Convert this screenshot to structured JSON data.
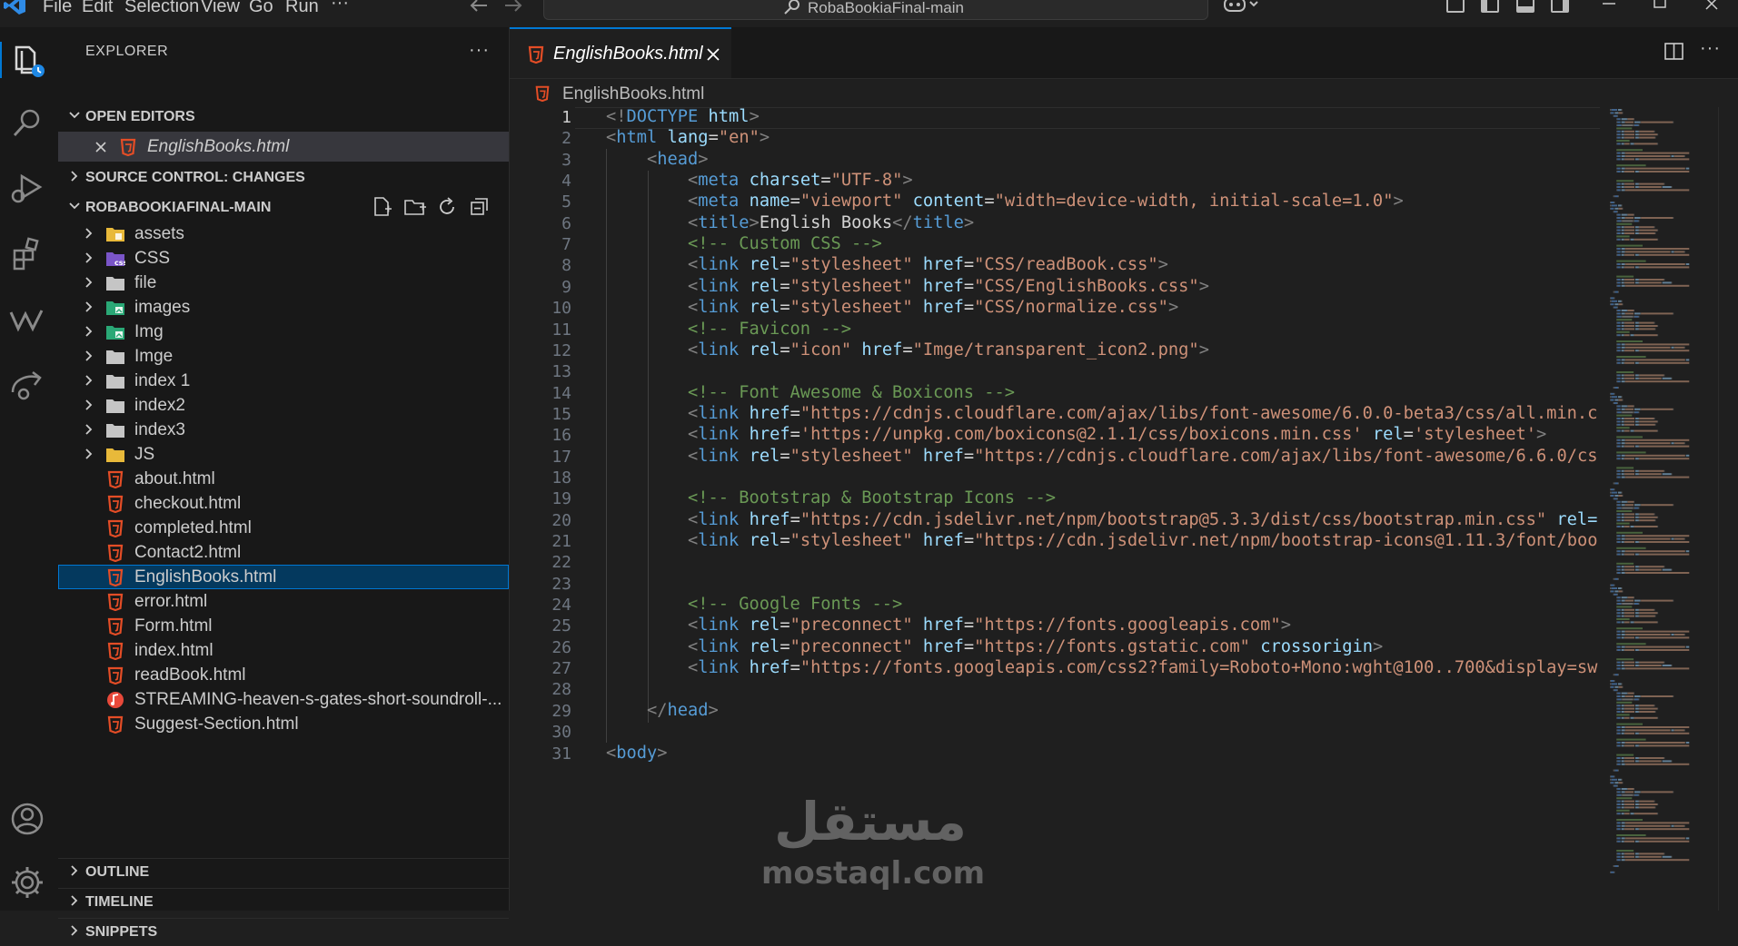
{
  "menu": {
    "items": [
      "File",
      "Edit",
      "Selection",
      "View",
      "Go",
      "Run",
      "···"
    ]
  },
  "titlebar": {
    "search_text": "RobaBookiaFinal-main"
  },
  "sidebar": {
    "title": "EXPLORER",
    "more": "···",
    "sections": {
      "open_editors": "OPEN EDITORS",
      "source_control": "SOURCE CONTROL: CHANGES",
      "project": "ROBABOOKIAFINAL-MAIN",
      "outline": "OUTLINE",
      "timeline": "TIMELINE",
      "snippets": "SNIPPETS"
    },
    "open_editor_file": "EnglishBooks.html",
    "tree": [
      {
        "label": "assets",
        "type": "folder",
        "icon": "folder-assets-icon"
      },
      {
        "label": "CSS",
        "type": "folder",
        "icon": "folder-css-icon"
      },
      {
        "label": "file",
        "type": "folder",
        "icon": "folder-icon"
      },
      {
        "label": "images",
        "type": "folder",
        "icon": "folder-images-icon"
      },
      {
        "label": "Img",
        "type": "folder",
        "icon": "folder-images-icon"
      },
      {
        "label": "Imge",
        "type": "folder",
        "icon": "folder-icon"
      },
      {
        "label": "index 1",
        "type": "folder",
        "icon": "folder-icon"
      },
      {
        "label": "index2",
        "type": "folder",
        "icon": "folder-icon"
      },
      {
        "label": "index3",
        "type": "folder",
        "icon": "folder-icon"
      },
      {
        "label": "JS",
        "type": "folder",
        "icon": "folder-js-icon"
      },
      {
        "label": "about.html",
        "type": "html",
        "icon": "html-file-icon"
      },
      {
        "label": "checkout.html",
        "type": "html",
        "icon": "html-file-icon"
      },
      {
        "label": "completed.html",
        "type": "html",
        "icon": "html-file-icon"
      },
      {
        "label": "Contact2.html",
        "type": "html",
        "icon": "html-file-icon"
      },
      {
        "label": "EnglishBooks.html",
        "type": "html",
        "icon": "html-file-icon",
        "selected": true
      },
      {
        "label": "error.html",
        "type": "html",
        "icon": "html-file-icon"
      },
      {
        "label": "Form.html",
        "type": "html",
        "icon": "html-file-icon"
      },
      {
        "label": "index.html",
        "type": "html",
        "icon": "html-file-icon"
      },
      {
        "label": "readBook.html",
        "type": "html",
        "icon": "html-file-icon"
      },
      {
        "label": "STREAMING-heaven-s-gates-short-soundroll-...",
        "type": "audio",
        "icon": "audio-file-icon"
      },
      {
        "label": "Suggest-Section.html",
        "type": "html",
        "icon": "html-file-icon"
      }
    ]
  },
  "editor": {
    "tab_label": "EnglishBooks.html",
    "breadcrumb": "EnglishBooks.html",
    "current_line": 1,
    "lines": [
      [
        [
          "t",
          "<!"
        ],
        [
          "tn",
          "DOCTYPE"
        ],
        [
          "tx",
          " "
        ],
        [
          "an",
          "html"
        ],
        [
          "t",
          ">"
        ]
      ],
      [
        [
          "t",
          "<"
        ],
        [
          "tn",
          "html"
        ],
        [
          "tx",
          " "
        ],
        [
          "an",
          "lang"
        ],
        [
          "tx",
          "="
        ],
        [
          "av",
          "\"en\""
        ],
        [
          "t",
          ">"
        ]
      ],
      [
        [
          "tx",
          "    "
        ],
        [
          "t",
          "<"
        ],
        [
          "tn",
          "head"
        ],
        [
          "t",
          ">"
        ]
      ],
      [
        [
          "tx",
          "        "
        ],
        [
          "t",
          "<"
        ],
        [
          "tn",
          "meta"
        ],
        [
          "tx",
          " "
        ],
        [
          "an",
          "charset"
        ],
        [
          "tx",
          "="
        ],
        [
          "av",
          "\"UTF-8\""
        ],
        [
          "t",
          ">"
        ]
      ],
      [
        [
          "tx",
          "        "
        ],
        [
          "t",
          "<"
        ],
        [
          "tn",
          "meta"
        ],
        [
          "tx",
          " "
        ],
        [
          "an",
          "name"
        ],
        [
          "tx",
          "="
        ],
        [
          "av",
          "\"viewport\""
        ],
        [
          "tx",
          " "
        ],
        [
          "an",
          "content"
        ],
        [
          "tx",
          "="
        ],
        [
          "av",
          "\"width=device-width, initial-scale=1.0\""
        ],
        [
          "t",
          ">"
        ]
      ],
      [
        [
          "tx",
          "        "
        ],
        [
          "t",
          "<"
        ],
        [
          "tn",
          "title"
        ],
        [
          "t",
          ">"
        ],
        [
          "tx",
          "English Books"
        ],
        [
          "t",
          "</"
        ],
        [
          "tn",
          "title"
        ],
        [
          "t",
          ">"
        ]
      ],
      [
        [
          "tx",
          "        "
        ],
        [
          "cm",
          "<!-- Custom CSS -->"
        ]
      ],
      [
        [
          "tx",
          "        "
        ],
        [
          "t",
          "<"
        ],
        [
          "tn",
          "link"
        ],
        [
          "tx",
          " "
        ],
        [
          "an",
          "rel"
        ],
        [
          "tx",
          "="
        ],
        [
          "av",
          "\"stylesheet\""
        ],
        [
          "tx",
          " "
        ],
        [
          "an",
          "href"
        ],
        [
          "tx",
          "="
        ],
        [
          "av",
          "\"CSS/readBook.css\""
        ],
        [
          "t",
          ">"
        ]
      ],
      [
        [
          "tx",
          "        "
        ],
        [
          "t",
          "<"
        ],
        [
          "tn",
          "link"
        ],
        [
          "tx",
          " "
        ],
        [
          "an",
          "rel"
        ],
        [
          "tx",
          "="
        ],
        [
          "av",
          "\"stylesheet\""
        ],
        [
          "tx",
          " "
        ],
        [
          "an",
          "href"
        ],
        [
          "tx",
          "="
        ],
        [
          "av",
          "\"CSS/EnglishBooks.css\""
        ],
        [
          "t",
          ">"
        ]
      ],
      [
        [
          "tx",
          "        "
        ],
        [
          "t",
          "<"
        ],
        [
          "tn",
          "link"
        ],
        [
          "tx",
          " "
        ],
        [
          "an",
          "rel"
        ],
        [
          "tx",
          "="
        ],
        [
          "av",
          "\"stylesheet\""
        ],
        [
          "tx",
          " "
        ],
        [
          "an",
          "href"
        ],
        [
          "tx",
          "="
        ],
        [
          "av",
          "\"CSS/normalize.css\""
        ],
        [
          "t",
          ">"
        ]
      ],
      [
        [
          "tx",
          "        "
        ],
        [
          "cm",
          "<!-- Favicon -->"
        ]
      ],
      [
        [
          "tx",
          "        "
        ],
        [
          "t",
          "<"
        ],
        [
          "tn",
          "link"
        ],
        [
          "tx",
          " "
        ],
        [
          "an",
          "rel"
        ],
        [
          "tx",
          "="
        ],
        [
          "av",
          "\"icon\""
        ],
        [
          "tx",
          " "
        ],
        [
          "an",
          "href"
        ],
        [
          "tx",
          "="
        ],
        [
          "av",
          "\"Imge/transparent_icon2.png\""
        ],
        [
          "t",
          ">"
        ]
      ],
      [],
      [
        [
          "tx",
          "        "
        ],
        [
          "cm",
          "<!-- Font Awesome & Boxicons -->"
        ]
      ],
      [
        [
          "tx",
          "        "
        ],
        [
          "t",
          "<"
        ],
        [
          "tn",
          "link"
        ],
        [
          "tx",
          " "
        ],
        [
          "an",
          "href"
        ],
        [
          "tx",
          "="
        ],
        [
          "av",
          "\"https://cdnjs.cloudflare.com/ajax/libs/font-awesome/6.0.0-beta3/css/all.min.c"
        ]
      ],
      [
        [
          "tx",
          "        "
        ],
        [
          "t",
          "<"
        ],
        [
          "tn",
          "link"
        ],
        [
          "tx",
          " "
        ],
        [
          "an",
          "href"
        ],
        [
          "tx",
          "="
        ],
        [
          "av",
          "'https://unpkg.com/boxicons@2.1.1/css/boxicons.min.css'"
        ],
        [
          "tx",
          " "
        ],
        [
          "an",
          "rel"
        ],
        [
          "tx",
          "="
        ],
        [
          "av",
          "'stylesheet'"
        ],
        [
          "t",
          ">"
        ]
      ],
      [
        [
          "tx",
          "        "
        ],
        [
          "t",
          "<"
        ],
        [
          "tn",
          "link"
        ],
        [
          "tx",
          " "
        ],
        [
          "an",
          "rel"
        ],
        [
          "tx",
          "="
        ],
        [
          "av",
          "\"stylesheet\""
        ],
        [
          "tx",
          " "
        ],
        [
          "an",
          "href"
        ],
        [
          "tx",
          "="
        ],
        [
          "av",
          "\"https://cdnjs.cloudflare.com/ajax/libs/font-awesome/6.6.0/cs"
        ]
      ],
      [],
      [
        [
          "tx",
          "        "
        ],
        [
          "cm",
          "<!-- Bootstrap & Bootstrap Icons -->"
        ]
      ],
      [
        [
          "tx",
          "        "
        ],
        [
          "t",
          "<"
        ],
        [
          "tn",
          "link"
        ],
        [
          "tx",
          " "
        ],
        [
          "an",
          "href"
        ],
        [
          "tx",
          "="
        ],
        [
          "av",
          "\"https://cdn.jsdelivr.net/npm/bootstrap@5.3.3/dist/css/bootstrap.min.css\""
        ],
        [
          "tx",
          " "
        ],
        [
          "an",
          "rel="
        ]
      ],
      [
        [
          "tx",
          "        "
        ],
        [
          "t",
          "<"
        ],
        [
          "tn",
          "link"
        ],
        [
          "tx",
          " "
        ],
        [
          "an",
          "rel"
        ],
        [
          "tx",
          "="
        ],
        [
          "av",
          "\"stylesheet\""
        ],
        [
          "tx",
          " "
        ],
        [
          "an",
          "href"
        ],
        [
          "tx",
          "="
        ],
        [
          "av",
          "\"https://cdn.jsdelivr.net/npm/bootstrap-icons@1.11.3/font/boo"
        ]
      ],
      [],
      [],
      [
        [
          "tx",
          "        "
        ],
        [
          "cm",
          "<!-- Google Fonts -->"
        ]
      ],
      [
        [
          "tx",
          "        "
        ],
        [
          "t",
          "<"
        ],
        [
          "tn",
          "link"
        ],
        [
          "tx",
          " "
        ],
        [
          "an",
          "rel"
        ],
        [
          "tx",
          "="
        ],
        [
          "av",
          "\"preconnect\""
        ],
        [
          "tx",
          " "
        ],
        [
          "an",
          "href"
        ],
        [
          "tx",
          "="
        ],
        [
          "av",
          "\"https://fonts.googleapis.com\""
        ],
        [
          "t",
          ">"
        ]
      ],
      [
        [
          "tx",
          "        "
        ],
        [
          "t",
          "<"
        ],
        [
          "tn",
          "link"
        ],
        [
          "tx",
          " "
        ],
        [
          "an",
          "rel"
        ],
        [
          "tx",
          "="
        ],
        [
          "av",
          "\"preconnect\""
        ],
        [
          "tx",
          " "
        ],
        [
          "an",
          "href"
        ],
        [
          "tx",
          "="
        ],
        [
          "av",
          "\"https://fonts.gstatic.com\""
        ],
        [
          "tx",
          " "
        ],
        [
          "an",
          "crossorigin"
        ],
        [
          "t",
          ">"
        ]
      ],
      [
        [
          "tx",
          "        "
        ],
        [
          "t",
          "<"
        ],
        [
          "tn",
          "link"
        ],
        [
          "tx",
          " "
        ],
        [
          "an",
          "href"
        ],
        [
          "tx",
          "="
        ],
        [
          "av",
          "\"https://fonts.googleapis.com/css2?family=Roboto+Mono:wght@100..700&display=sw"
        ]
      ],
      [],
      [
        [
          "tx",
          "    "
        ],
        [
          "t",
          "</"
        ],
        [
          "tn",
          "head"
        ],
        [
          "t",
          ">"
        ]
      ],
      [],
      [
        [
          "t",
          "<"
        ],
        [
          "tn",
          "body"
        ],
        [
          "t",
          ">"
        ]
      ]
    ]
  },
  "watermark": {
    "arabic": "مستقل",
    "latin": "mostaql.com"
  },
  "colors": {
    "accent": "#0078d4",
    "selection": "#04395e",
    "html_icon": "#e44d26"
  }
}
